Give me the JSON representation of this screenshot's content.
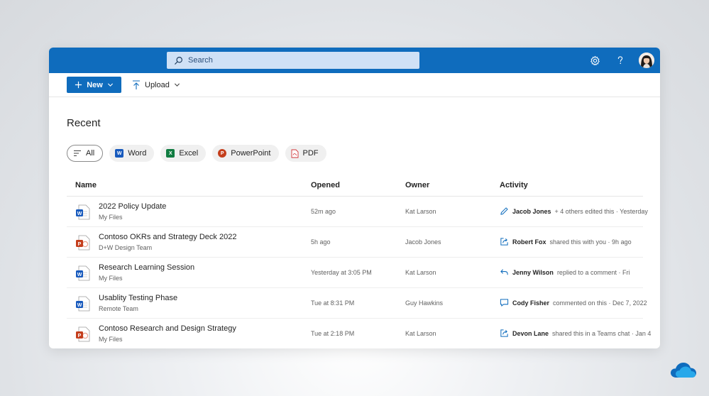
{
  "search": {
    "placeholder": "Search"
  },
  "toolbar": {
    "new_label": "New",
    "upload_label": "Upload"
  },
  "section_title": "Recent",
  "filters": [
    {
      "label": "All",
      "icon": "list-icon",
      "active": true
    },
    {
      "label": "Word",
      "icon": "word-icon",
      "color": "#185abd"
    },
    {
      "label": "Excel",
      "icon": "excel-icon",
      "color": "#107c41"
    },
    {
      "label": "PowerPoint",
      "icon": "powerpoint-icon",
      "color": "#c43e1c"
    },
    {
      "label": "PDF",
      "icon": "pdf-icon",
      "color": "#d13438"
    }
  ],
  "columns": {
    "name": "Name",
    "opened": "Opened",
    "owner": "Owner",
    "activity": "Activity"
  },
  "files": [
    {
      "name": "2022 Policy Update",
      "location": "My Files",
      "type": "word",
      "opened": "52m ago",
      "owner": "Kat Larson",
      "activity_icon": "pencil-icon",
      "activity_person": "Jacob Jones",
      "activity_text": "+ 4 others edited this · Yesterday"
    },
    {
      "name": "Contoso OKRs and Strategy Deck 2022",
      "location": "D+W Design Team",
      "type": "powerpoint",
      "opened": "5h ago",
      "owner": "Jacob Jones",
      "activity_icon": "share-icon",
      "activity_person": "Robert Fox",
      "activity_text": "shared this with you · 9h ago"
    },
    {
      "name": "Research Learning Session",
      "location": "My Files",
      "type": "word",
      "opened": "Yesterday at 3:05 PM",
      "owner": "Kat Larson",
      "activity_icon": "reply-icon",
      "activity_person": "Jenny Wilson",
      "activity_text": "replied to a comment · Fri"
    },
    {
      "name": "Usablity Testing Phase",
      "location": "Remote Team",
      "type": "word",
      "opened": "Tue at 8:31 PM",
      "owner": "Guy Hawkins",
      "activity_icon": "comment-icon",
      "activity_person": "Cody Fisher",
      "activity_text": "commented on this · Dec 7, 2022"
    },
    {
      "name": "Contoso Research and Design Strategy",
      "location": "My Files",
      "type": "powerpoint",
      "opened": "Tue at 2:18 PM",
      "owner": "Kat Larson",
      "activity_icon": "share-icon",
      "activity_person": "Devon Lane",
      "activity_text": "shared this in a Teams chat · Jan 4"
    }
  ],
  "colors": {
    "brand": "#0f6cbd",
    "word": "#185abd",
    "powerpoint": "#c43e1c",
    "excel": "#107c41",
    "pdf": "#d13438"
  }
}
